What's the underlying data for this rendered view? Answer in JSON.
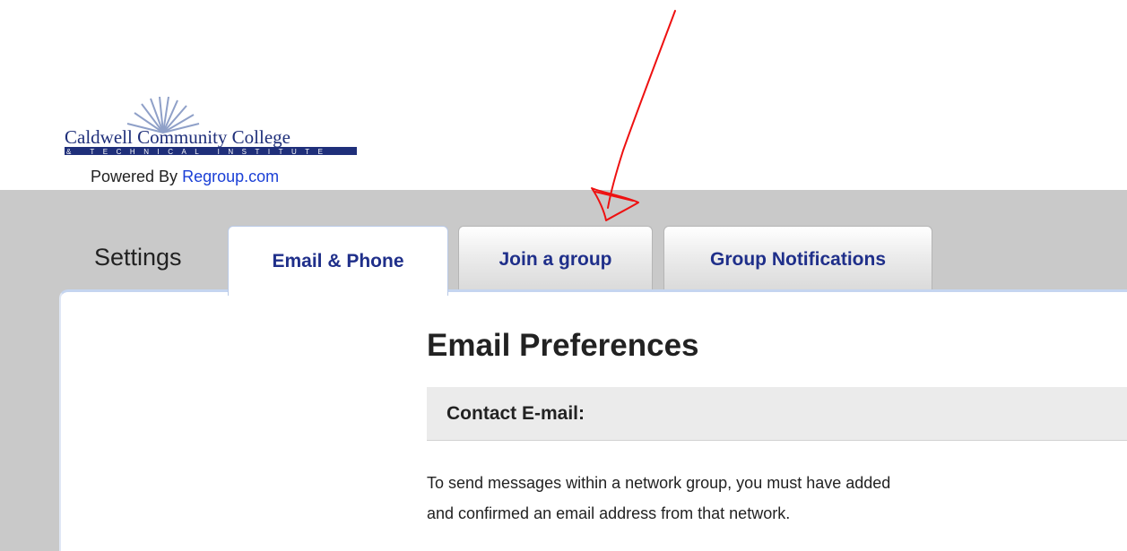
{
  "branding": {
    "college_line1": "Caldwell Community College",
    "college_line2": "& TECHNICAL INSTITUTE",
    "powered_prefix": "Powered By",
    "powered_link": "Regroup.com"
  },
  "settings": {
    "label": "Settings",
    "tabs": [
      {
        "label": "Email & Phone",
        "active": true
      },
      {
        "label": "Join a group",
        "active": false
      },
      {
        "label": "Group Notifications",
        "active": false
      }
    ]
  },
  "content": {
    "heading": "Email Preferences",
    "section_title": "Contact E-mail:",
    "description_line1": "To send messages within a network group, you must have added",
    "description_line2": "and confirmed an email address from that network."
  },
  "colors": {
    "band": "#c9c9c9",
    "tab_text": "#1f2f8a",
    "link": "#1a3fd6",
    "annotation": "#ee1111"
  },
  "annotation": {
    "icon": "red-arrow-icon"
  }
}
